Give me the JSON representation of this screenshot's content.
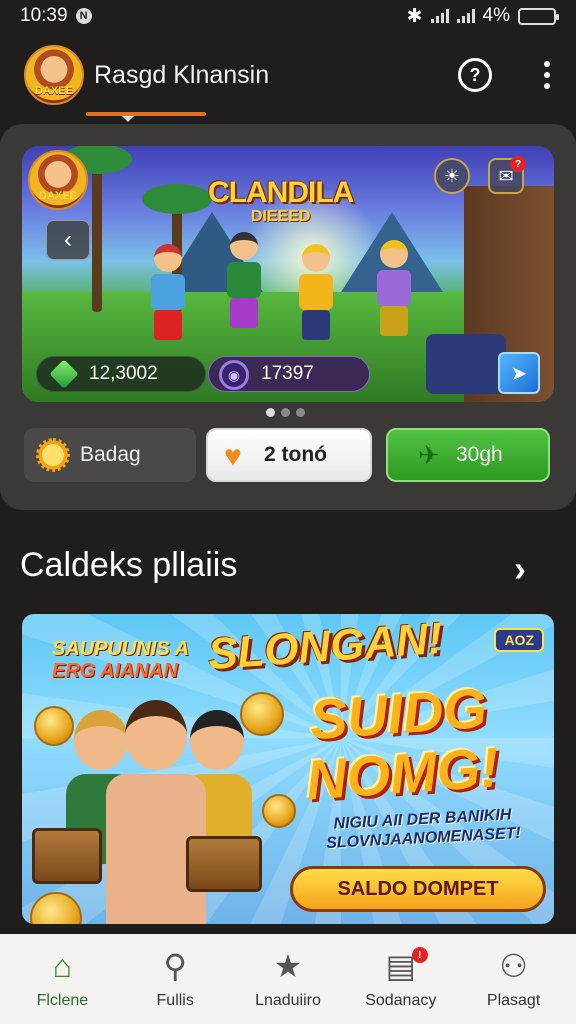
{
  "status_bar": {
    "time": "10:39",
    "battery": "4%"
  },
  "header": {
    "logo_text": "DAXEE",
    "title": "Rasgd Klnansin"
  },
  "hero": {
    "logo_text": "DAXEE",
    "title_line1": "CLANDILA",
    "title_line2": "DIEEED",
    "gems": "12,3002",
    "coins": "17397",
    "notif_count": "?"
  },
  "carousel": {
    "pages": 3,
    "active": 0
  },
  "quick_actions": [
    {
      "label": "Badag",
      "icon": "sun-icon"
    },
    {
      "label": "2 tonó",
      "icon": "heart-icon"
    },
    {
      "label": "30gh",
      "icon": "plane-icon"
    }
  ],
  "section": {
    "title": "Caldeks pllaiis"
  },
  "promo": {
    "line1": "SAUPUUNIS A",
    "line2": "ERG AIANAN",
    "big": "SLONGAN!",
    "tag": "AOZ",
    "huge_line1": "SUIDG",
    "huge_line2": "NOMG!",
    "sub": "NIGIU AII DER BANIKIH SLOVNJAANOMENASET!",
    "cta": "SALDO DOMPET"
  },
  "nav": [
    {
      "label": "Flclene",
      "icon": "home-icon",
      "active": true
    },
    {
      "label": "Fullis",
      "icon": "rackets-icon",
      "active": false
    },
    {
      "label": "Lnaduiiro",
      "icon": "star-icon",
      "active": false
    },
    {
      "label": "Sodanacy",
      "icon": "wallet-icon",
      "active": false,
      "badge": "!"
    },
    {
      "label": "Plasagt",
      "icon": "profile-icon",
      "active": false
    }
  ],
  "colors": {
    "accent": "#e2711d",
    "boost_green": "#3aa82e",
    "background": "#1f1e1c"
  }
}
